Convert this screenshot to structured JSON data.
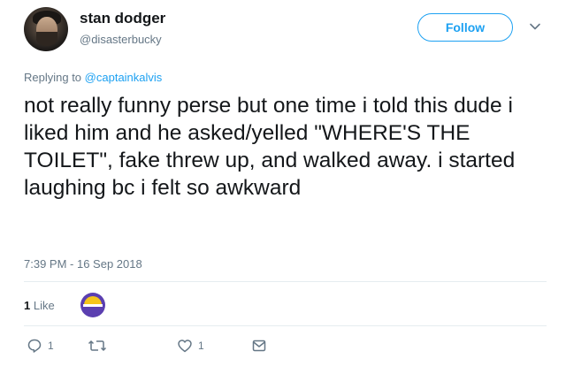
{
  "author": {
    "display_name": "stan dodger",
    "handle": "@disasterbucky"
  },
  "follow_label": "Follow",
  "replying": {
    "prefix": "Replying to",
    "mention": "@captainkalvis"
  },
  "tweet_text": "not really funny perse but one time i told this dude i liked him and he asked/yelled \"WHERE'S THE TOILET\", fake threw up, and walked away. i started laughing bc i felt so awkward",
  "timestamp": "7:39 PM - 16 Sep 2018",
  "stats": {
    "likes_number": "1",
    "likes_label": "Like"
  },
  "actions": {
    "reply_icon": "reply-icon",
    "reply_count": "1",
    "retweet_icon": "retweet-icon",
    "like_icon": "heart-icon",
    "like_count": "1",
    "message_icon": "envelope-icon"
  },
  "colors": {
    "accent": "#1da1f2",
    "secondary_text": "#657786",
    "primary_text": "#14171a",
    "divider": "#e6ecf0"
  }
}
